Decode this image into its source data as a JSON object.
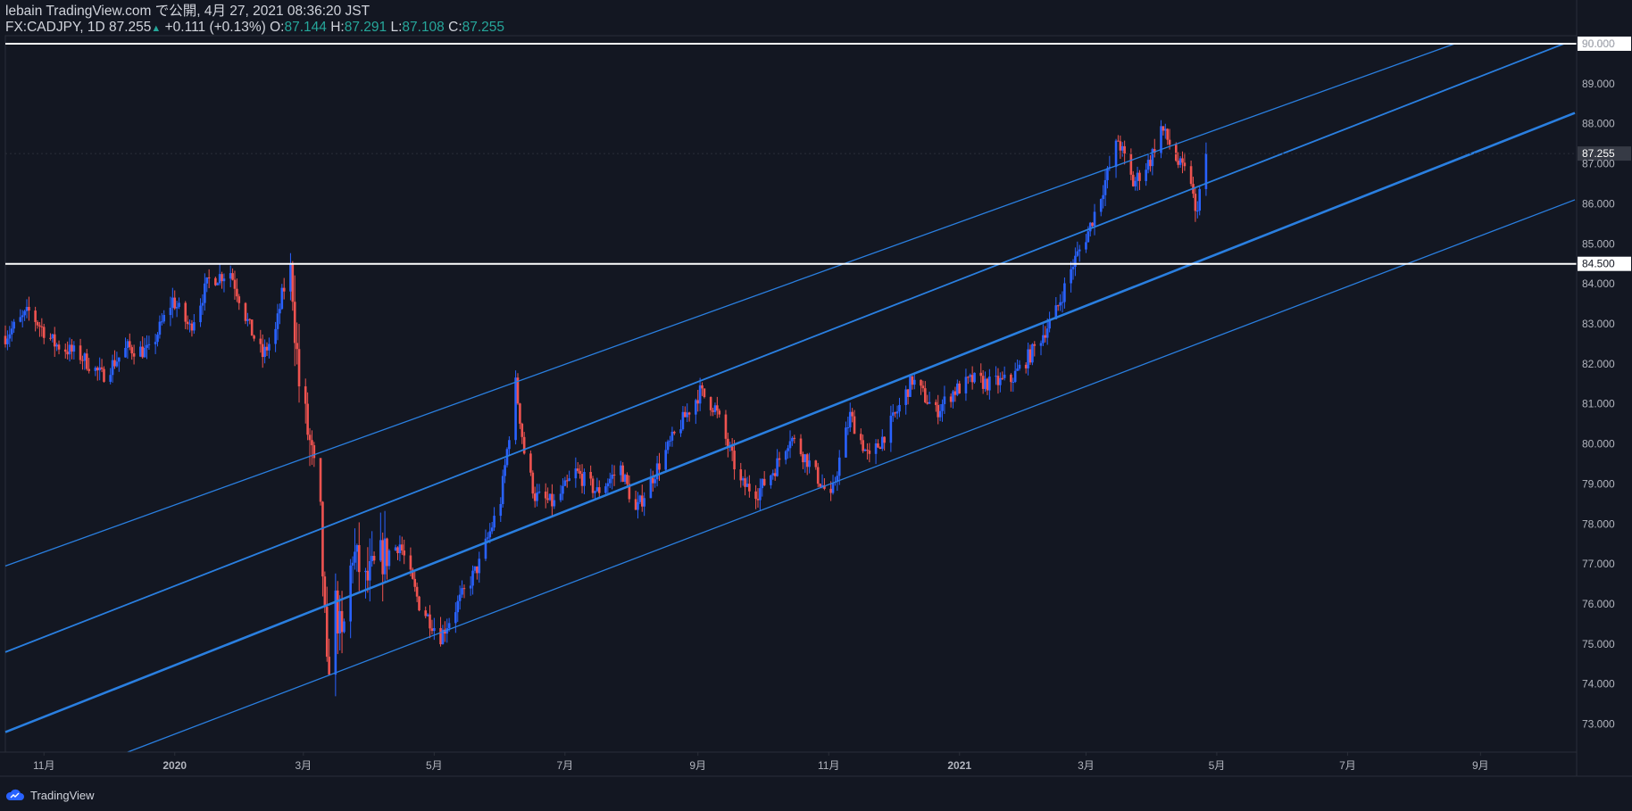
{
  "header": {
    "published": "lebain TradingView.com で公開, 4月 27, 2021 08:36:20 JST",
    "symbol": "FX:CADJPY, 1D 87.255",
    "change": "+0.111 (+0.13%)",
    "open_label": "O:",
    "open": "87.144",
    "high_label": "H:",
    "high": "87.291",
    "low_label": "L:",
    "low": "87.108",
    "close_label": "C:",
    "close": "87.255"
  },
  "footer": {
    "brand": "TradingView"
  },
  "colors": {
    "background": "#131722",
    "bull": "#2962ff",
    "bear": "#ef5350",
    "channel": "#2a7fe0",
    "level": "#ffffff",
    "axis_text": "#b2b5be",
    "badge": "#363a45"
  },
  "icons": {
    "logo": "tradingview-cloud-icon",
    "arrow": "up-triangle-icon"
  },
  "chart_data": {
    "type": "candlestick",
    "title": "FX:CADJPY, 1D",
    "x_start": "2019-10-14",
    "x_end": "2021-10-15",
    "ylim": [
      72.3,
      90.2
    ],
    "y_ticks": [
      "73.000",
      "74.000",
      "75.000",
      "76.000",
      "77.000",
      "78.000",
      "79.000",
      "80.000",
      "81.000",
      "82.000",
      "83.000",
      "84.000",
      "85.000",
      "86.000",
      "87.000",
      "88.000",
      "89.000",
      "90.000"
    ],
    "x_ticks": [
      {
        "label": "11月",
        "date": "2019-11-01"
      },
      {
        "label": "2020",
        "date": "2020-01-01"
      },
      {
        "label": "3月",
        "date": "2020-03-01"
      },
      {
        "label": "5月",
        "date": "2020-05-01"
      },
      {
        "label": "7月",
        "date": "2020-07-01"
      },
      {
        "label": "9月",
        "date": "2020-09-01"
      },
      {
        "label": "11月",
        "date": "2020-11-01"
      },
      {
        "label": "2021",
        "date": "2021-01-01"
      },
      {
        "label": "3月",
        "date": "2021-03-01"
      },
      {
        "label": "5月",
        "date": "2021-05-01"
      },
      {
        "label": "7月",
        "date": "2021-07-01"
      },
      {
        "label": "9月",
        "date": "2021-09-01"
      }
    ],
    "price_path": [
      [
        "2019-10-14",
        82.7
      ],
      [
        "2019-10-25",
        83.3
      ],
      [
        "2019-11-06",
        82.5
      ],
      [
        "2019-11-18",
        82.2
      ],
      [
        "2019-11-28",
        81.7
      ],
      [
        "2019-12-10",
        82.4
      ],
      [
        "2019-12-20",
        82.3
      ],
      [
        "2019-12-31",
        83.6
      ],
      [
        "2020-01-08",
        82.9
      ],
      [
        "2020-01-17",
        84.1
      ],
      [
        "2020-01-27",
        84.3
      ],
      [
        "2020-02-05",
        82.9
      ],
      [
        "2020-02-11",
        82.2
      ],
      [
        "2020-02-17",
        82.8
      ],
      [
        "2020-02-20",
        83.7
      ],
      [
        "2020-02-24",
        84.4
      ],
      [
        "2020-02-28",
        81.5
      ],
      [
        "2020-03-04",
        80.0
      ],
      [
        "2020-03-09",
        78.1
      ],
      [
        "2020-03-12",
        74.2
      ],
      [
        "2020-03-16",
        76.0
      ],
      [
        "2020-03-19",
        75.0
      ],
      [
        "2020-03-24",
        77.3
      ],
      [
        "2020-03-30",
        76.5
      ],
      [
        "2020-04-07",
        77.2
      ],
      [
        "2020-04-15",
        77.5
      ],
      [
        "2020-04-24",
        76.0
      ],
      [
        "2020-05-04",
        75.2
      ],
      [
        "2020-05-14",
        76.2
      ],
      [
        "2020-05-22",
        77.0
      ],
      [
        "2020-06-01",
        78.6
      ],
      [
        "2020-06-08",
        81.5
      ],
      [
        "2020-06-12",
        79.8
      ],
      [
        "2020-06-17",
        78.7
      ],
      [
        "2020-06-26",
        78.5
      ],
      [
        "2020-07-06",
        79.3
      ],
      [
        "2020-07-16",
        78.8
      ],
      [
        "2020-07-27",
        79.4
      ],
      [
        "2020-08-03",
        78.3
      ],
      [
        "2020-08-13",
        79.4
      ],
      [
        "2020-08-24",
        80.5
      ],
      [
        "2020-09-02",
        81.3
      ],
      [
        "2020-09-09",
        80.9
      ],
      [
        "2020-09-21",
        79.0
      ],
      [
        "2020-09-29",
        78.8
      ],
      [
        "2020-10-07",
        79.4
      ],
      [
        "2020-10-14",
        80.2
      ],
      [
        "2020-10-22",
        79.6
      ],
      [
        "2020-11-02",
        78.6
      ],
      [
        "2020-11-06",
        79.6
      ],
      [
        "2020-11-11",
        80.7
      ],
      [
        "2020-11-20",
        79.6
      ],
      [
        "2020-12-01",
        80.6
      ],
      [
        "2020-12-10",
        81.6
      ],
      [
        "2020-12-21",
        80.8
      ],
      [
        "2020-12-29",
        81.3
      ],
      [
        "2021-01-07",
        81.6
      ],
      [
        "2021-01-15",
        81.5
      ],
      [
        "2021-01-25",
        81.6
      ],
      [
        "2021-02-04",
        82.3
      ],
      [
        "2021-02-15",
        83.3
      ],
      [
        "2021-02-23",
        84.5
      ],
      [
        "2021-03-02",
        85.3
      ],
      [
        "2021-03-09",
        86.4
      ],
      [
        "2021-03-16",
        87.6
      ],
      [
        "2021-03-23",
        86.5
      ],
      [
        "2021-03-31",
        87.1
      ],
      [
        "2021-04-05",
        87.9
      ],
      [
        "2021-04-09",
        87.5
      ],
      [
        "2021-04-13",
        87.0
      ],
      [
        "2021-04-19",
        86.6
      ],
      [
        "2021-04-21",
        85.7
      ],
      [
        "2021-04-26",
        87.255
      ]
    ],
    "horizontal_levels": [
      {
        "value": 84.5,
        "label": "84.500"
      },
      {
        "value": 90.0,
        "label": "90.000"
      }
    ],
    "last_price": {
      "value": 87.255,
      "label": "87.255"
    },
    "channel_lines": [
      {
        "p1": [
          "2019-10-14",
          76.95
        ],
        "p2": [
          "2021-08-20",
          90.0
        ],
        "style": "thin"
      },
      {
        "p1": [
          "2019-10-14",
          74.8
        ],
        "p2": [
          "2021-10-10",
          90.0
        ],
        "style": "medium"
      },
      {
        "p1": [
          "2019-10-14",
          72.8
        ],
        "p2": [
          "2021-10-15",
          88.27
        ],
        "style": "thick"
      },
      {
        "p1": [
          "2019-12-10",
          72.3
        ],
        "p2": [
          "2021-10-15",
          86.1
        ],
        "style": "thin"
      }
    ]
  }
}
